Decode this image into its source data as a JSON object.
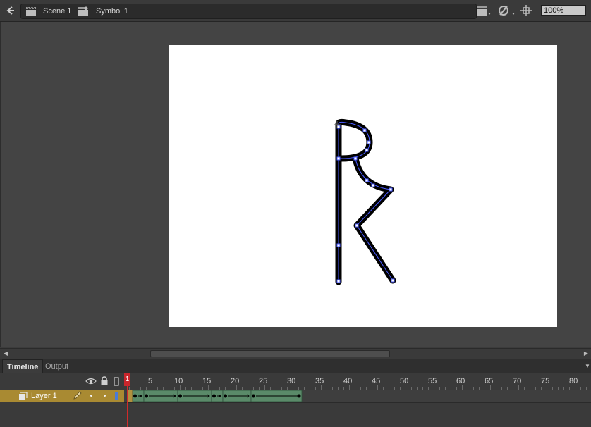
{
  "editbar": {
    "scene_label": "Scene 1",
    "symbol_label": "Symbol 1",
    "zoom": "100%"
  },
  "panel_tabs": [
    "Timeline",
    "Output"
  ],
  "timeline": {
    "ruler_numbers": [
      "1",
      "5",
      "10",
      "15",
      "20",
      "25",
      "30",
      "35",
      "40",
      "45",
      "50",
      "55",
      "60",
      "65",
      "70",
      "75",
      "80"
    ],
    "current_frame": "1",
    "layers": [
      {
        "name": "Layer 1"
      }
    ],
    "tween_spans": [
      [
        1,
        2
      ],
      [
        3,
        8
      ],
      [
        9,
        14
      ],
      [
        15,
        16
      ],
      [
        17,
        21
      ],
      [
        22,
        30
      ]
    ]
  },
  "colors": {
    "playhead": "#c8262c",
    "layer_selected": "#a98a32",
    "tween_fill": "#5a8a69",
    "stage": "#ffffff",
    "path": "#4b5cff"
  }
}
